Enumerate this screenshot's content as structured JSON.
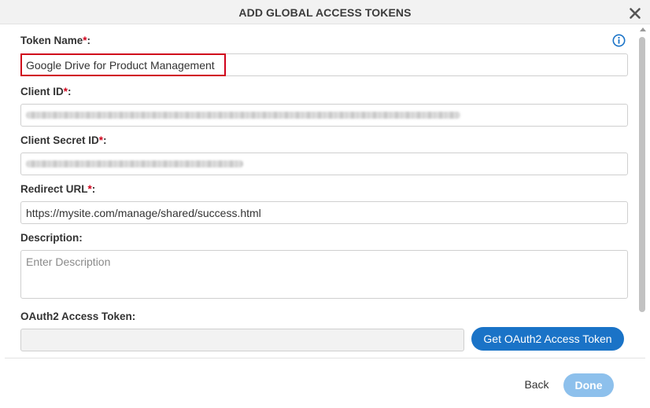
{
  "dialog": {
    "title": "ADD GLOBAL ACCESS TOKENS",
    "close_icon": "close-icon",
    "info_icon": "info-icon"
  },
  "form": {
    "token_name": {
      "label": "Token Name",
      "required_mark": "*",
      "suffix": ":",
      "value": "Google Drive for Product Management"
    },
    "client_id": {
      "label": "Client ID",
      "required_mark": "*",
      "suffix": ":"
    },
    "client_secret_id": {
      "label": "Client Secret ID",
      "required_mark": "*",
      "suffix": ":"
    },
    "redirect_url": {
      "label": "Redirect URL",
      "required_mark": "*",
      "suffix": ":",
      "value": "https://mysite.com/manage/shared/success.html"
    },
    "description": {
      "label": "Description:",
      "placeholder": "Enter Description"
    },
    "oauth2_token": {
      "label": "OAuth2 Access Token:",
      "value": "",
      "button_label": "Get OAuth2 Access Token"
    }
  },
  "footer": {
    "back_label": "Back",
    "done_label": "Done"
  },
  "colors": {
    "accent": "#1a73c7",
    "required": "#d0021b",
    "done_disabled": "#8dc0ec"
  }
}
